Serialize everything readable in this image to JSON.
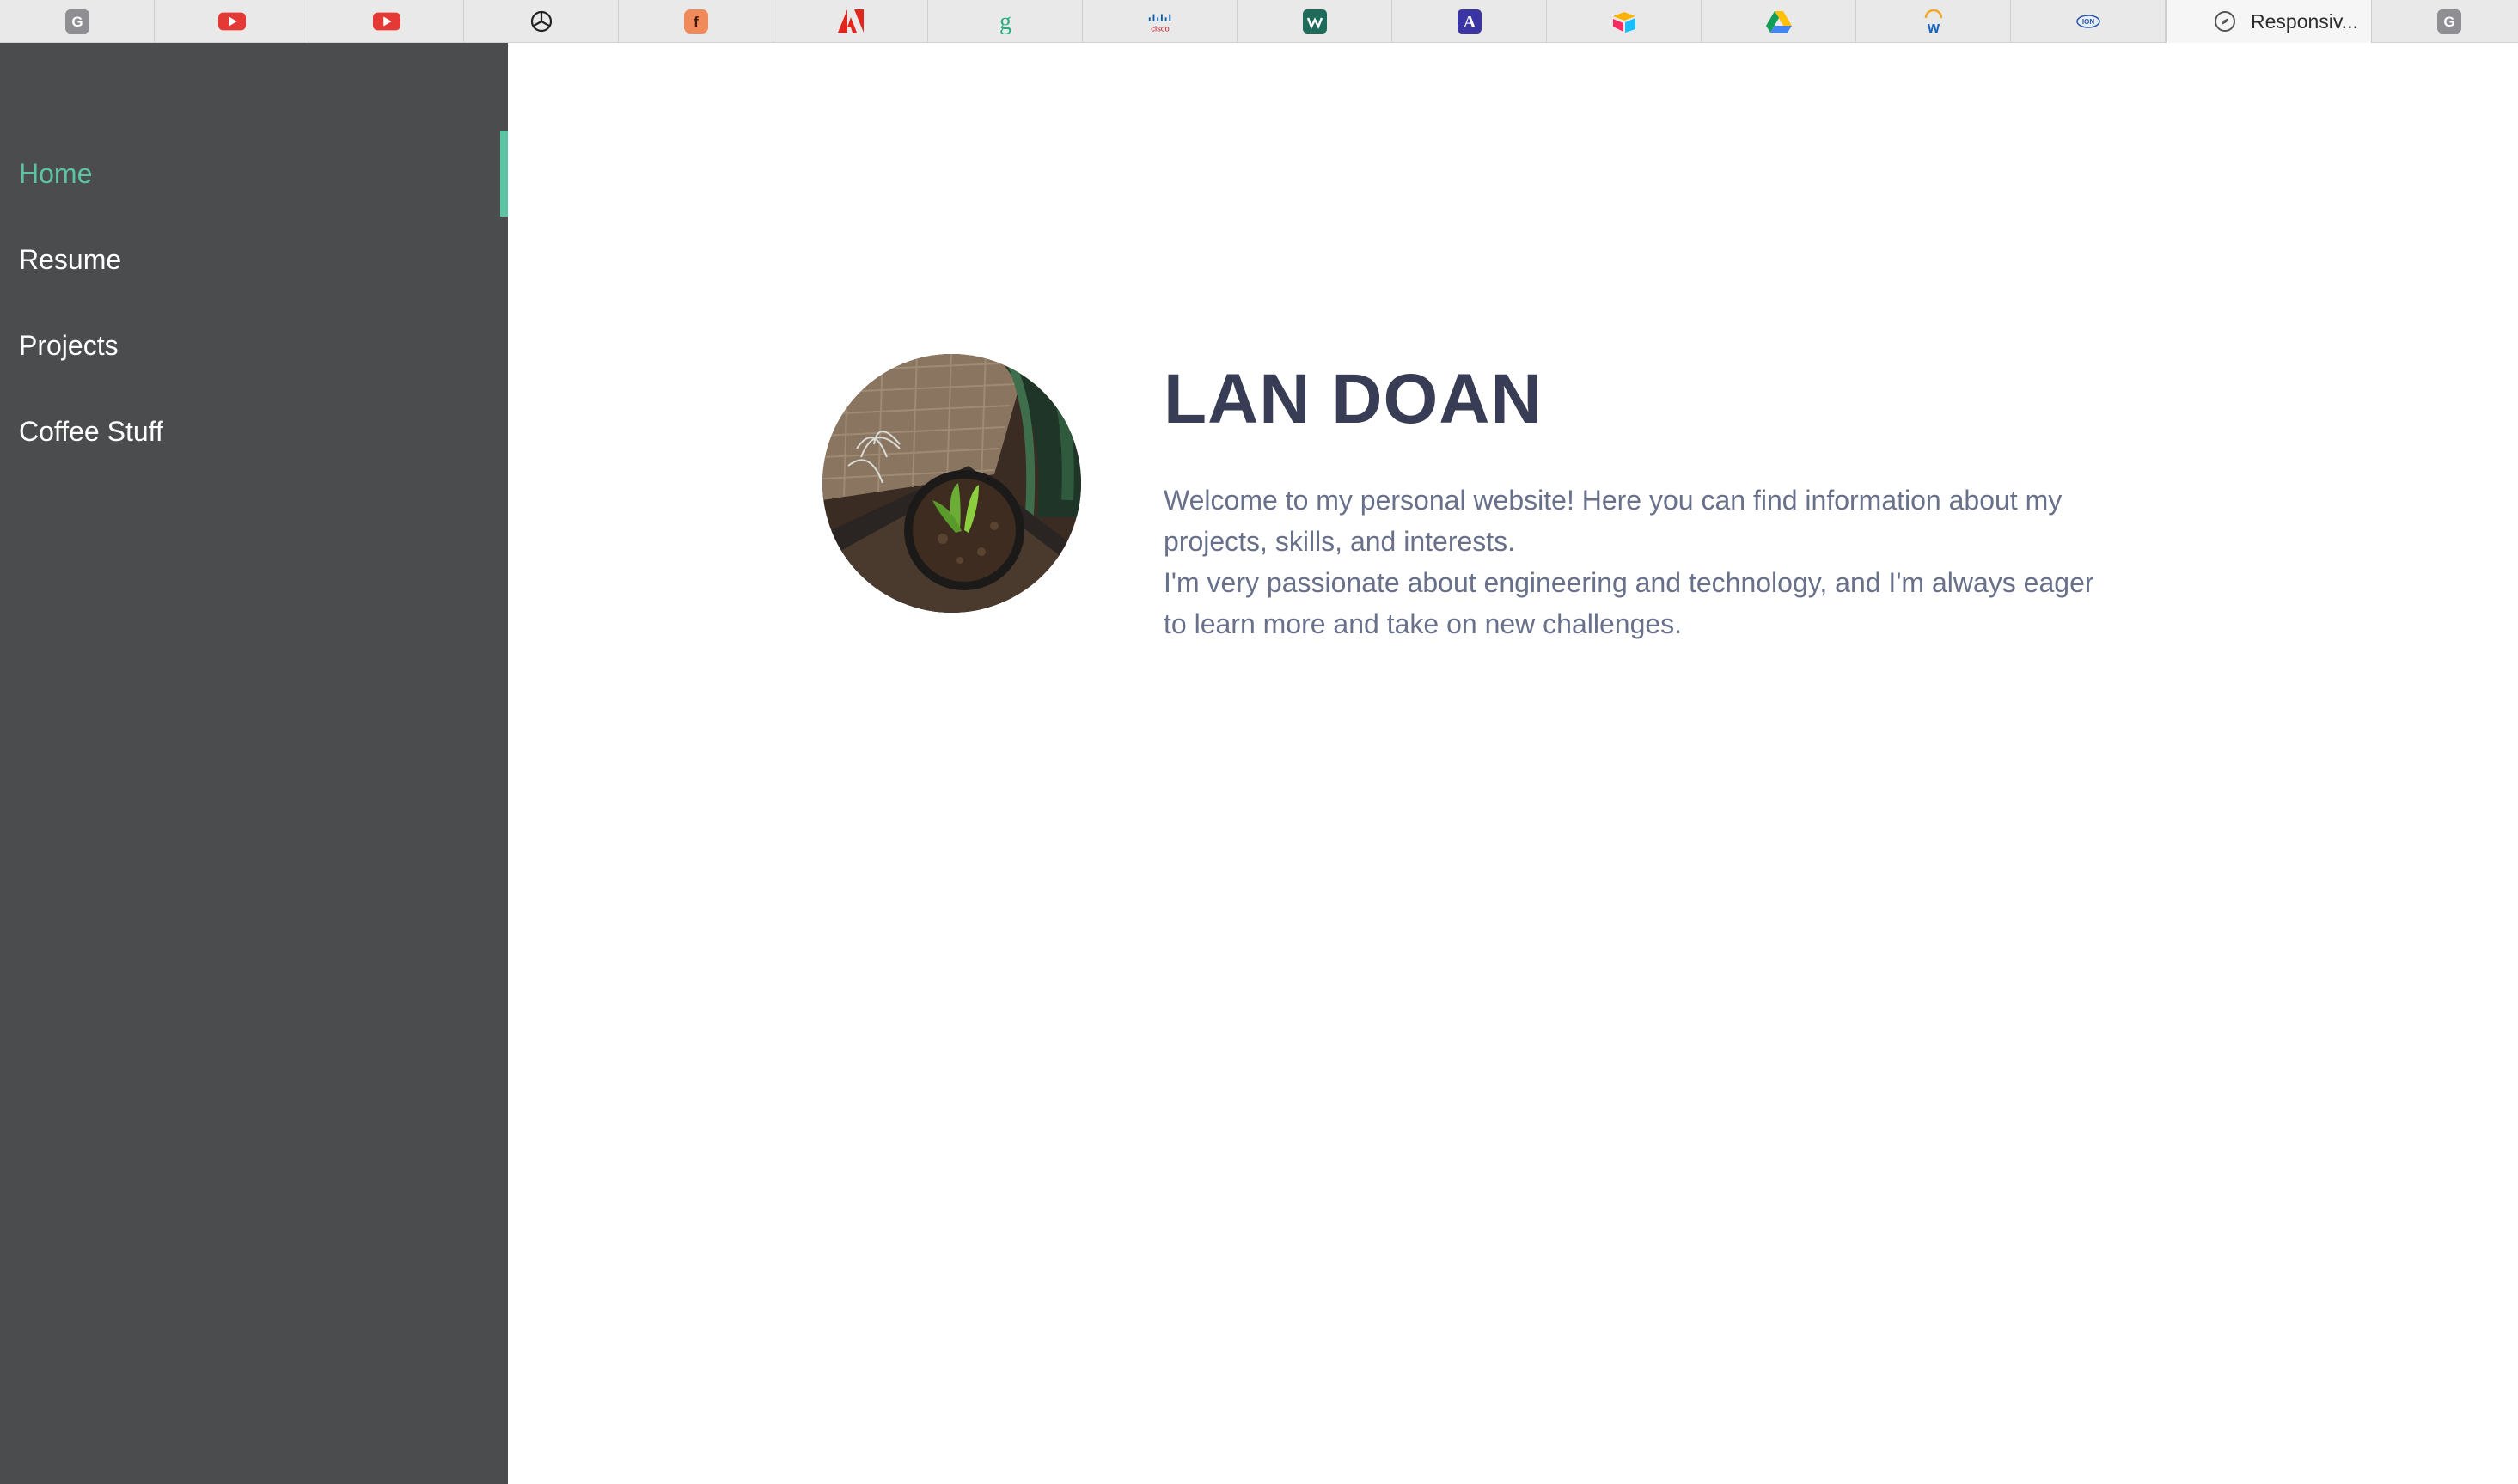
{
  "browser": {
    "tabs": [
      {
        "icon": "grammarly-icon"
      },
      {
        "icon": "youtube-icon"
      },
      {
        "icon": "youtube-icon"
      },
      {
        "icon": "openai-icon"
      },
      {
        "icon": "figma-icon"
      },
      {
        "icon": "adobe-icon"
      },
      {
        "icon": "grammarly-g-icon"
      },
      {
        "icon": "cisco-icon"
      },
      {
        "icon": "webflow-icon"
      },
      {
        "icon": "a-app-icon"
      },
      {
        "icon": "airtable-icon"
      },
      {
        "icon": "google-drive-icon"
      },
      {
        "icon": "workday-icon"
      },
      {
        "icon": "shell-icon"
      },
      {
        "icon": "compass-icon",
        "title": "Responsiv...",
        "active": true
      },
      {
        "icon": "grammarly-icon"
      }
    ]
  },
  "sidebar": {
    "items": [
      {
        "label": "Home",
        "active": true
      },
      {
        "label": "Resume"
      },
      {
        "label": "Projects"
      },
      {
        "label": "Coffee Stuff"
      }
    ],
    "accent_color": "#5cc3a4"
  },
  "profile": {
    "name": "LAN DOAN",
    "intro_line1": "Welcome to my personal website! Here you can find information about my projects, skills, and interests.",
    "intro_line2": "I'm very passionate about engineering and technology, and I'm always eager to learn more and take on new challenges."
  }
}
